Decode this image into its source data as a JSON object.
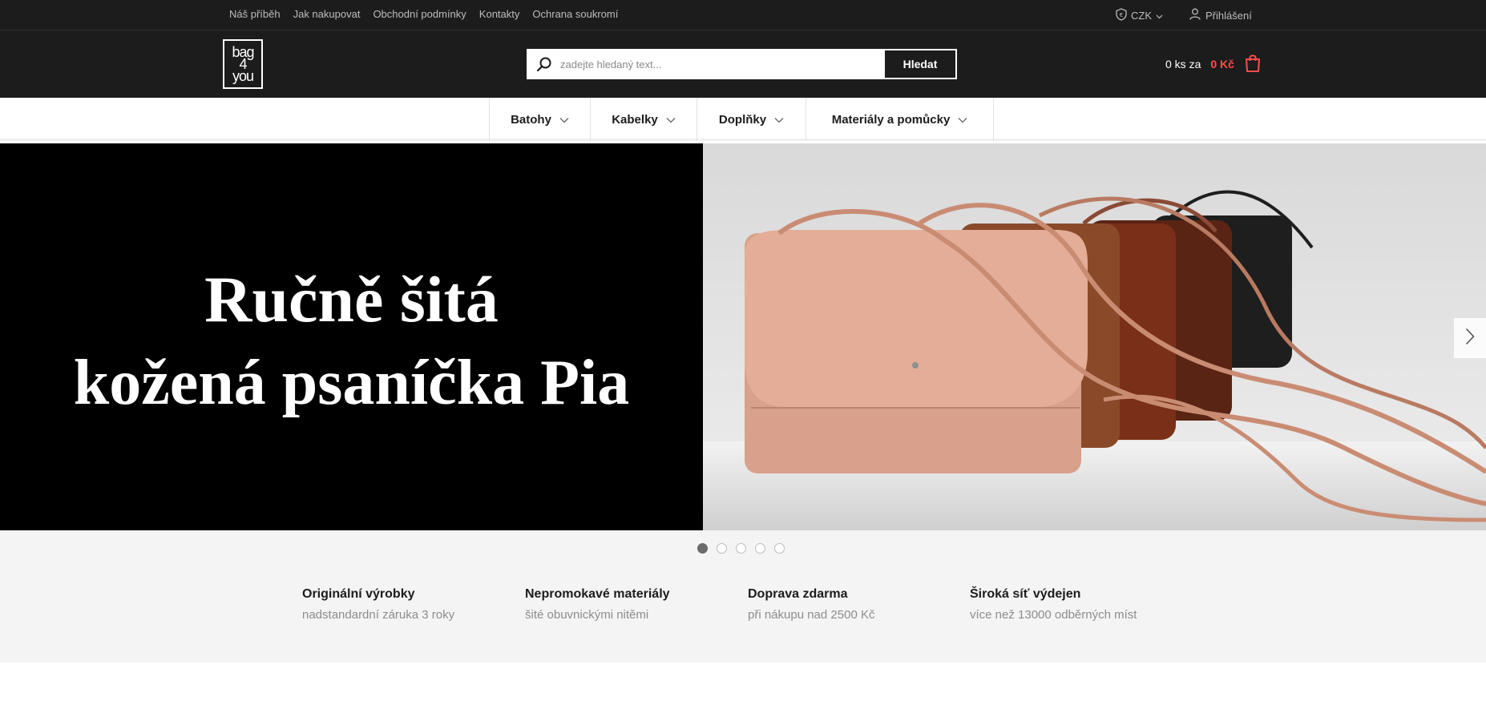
{
  "topbar": {
    "links": [
      "Náš příběh",
      "Jak nakupovat",
      "Obchodní podmínky",
      "Kontakty",
      "Ochrana soukromí"
    ],
    "currency": "CZK",
    "login": "Přihlášení"
  },
  "header": {
    "logo_lines": [
      "bag",
      "4",
      "you"
    ],
    "search": {
      "placeholder": "zadejte hledaný text...",
      "button": "Hledat"
    },
    "cart": {
      "count": "0 ks za",
      "total": "0 Kč"
    }
  },
  "categories": [
    "Batohy",
    "Kabelky",
    "Doplňky",
    "Materiály a pomůcky"
  ],
  "hero": {
    "line1": "Ručně šitá",
    "line2": "kožená psaníčka Pia",
    "slide_count": 5,
    "active_slide": 1
  },
  "benefits": [
    {
      "title": "Originální výrobky",
      "subtitle": "nadstandardní záruka 3 roky"
    },
    {
      "title": "Nepromokavé materiály",
      "subtitle": "šité obuvnickými nitěmi"
    },
    {
      "title": "Doprava zdarma",
      "subtitle": "při nákupu nad 2500 Kč"
    },
    {
      "title": "Široká síť výdejen",
      "subtitle": "více než 13000 odběrných míst"
    }
  ],
  "colors": {
    "dark": "#1c1c1c",
    "accent_red": "#ff4c4c",
    "muted_text": "#8d8d8d"
  },
  "icons": [
    "shield-euro-icon",
    "chevron-down-icon",
    "user-icon",
    "search-icon",
    "shopping-bag-icon",
    "chevron-right-icon"
  ]
}
